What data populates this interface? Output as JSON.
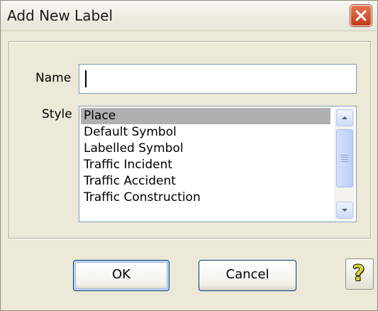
{
  "window": {
    "title": "Add New Label"
  },
  "form": {
    "name_label": "Name",
    "name_value": "",
    "style_label": "Style",
    "style_options": [
      "Place",
      "Default Symbol",
      "Labelled Symbol",
      "Traffic Incident",
      "Traffic Accident",
      "Traffic Construction"
    ],
    "selected_style": "Place"
  },
  "buttons": {
    "ok": "OK",
    "cancel": "Cancel",
    "help": "?"
  },
  "icons": {
    "close": "close-icon",
    "help": "help-icon",
    "scroll_up": "chevron-up-icon",
    "scroll_down": "chevron-down-icon"
  },
  "colors": {
    "close_button": "#c03b1a",
    "selection": "#b0b0b0",
    "help_glyph": "#d9cf3a"
  }
}
